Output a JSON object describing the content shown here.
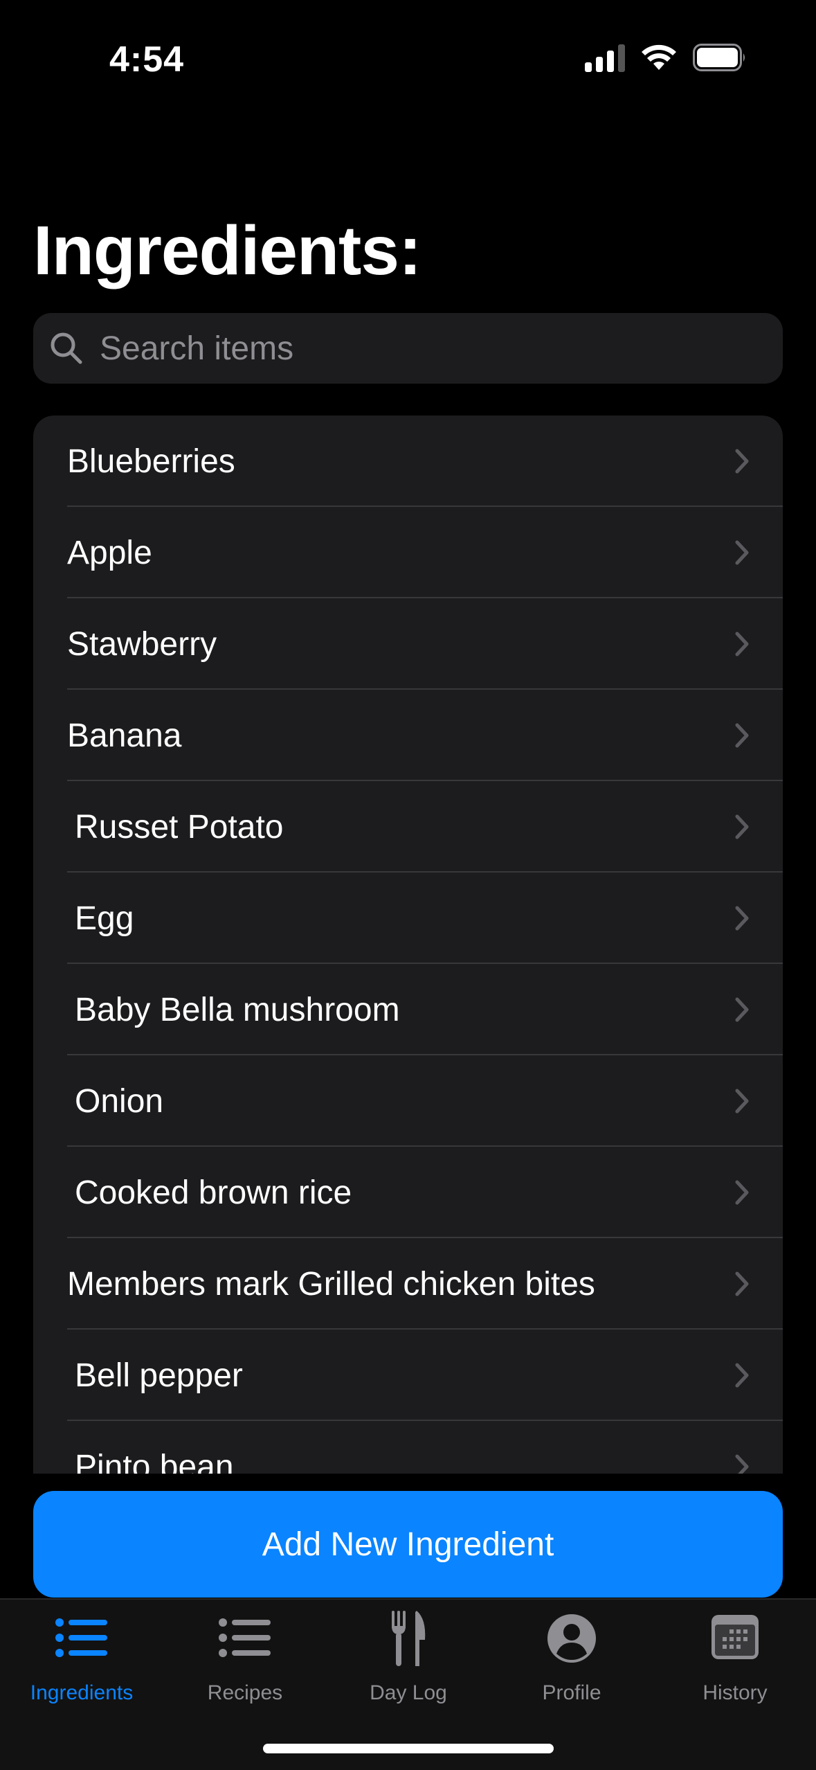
{
  "status_bar": {
    "time": "4:54"
  },
  "title": "Ingredients:",
  "search": {
    "placeholder": "Search items",
    "value": ""
  },
  "ingredients": [
    {
      "label": "Blueberries"
    },
    {
      "label": "Apple"
    },
    {
      "label": "Stawberry"
    },
    {
      "label": "Banana"
    },
    {
      "label": "Russet Potato"
    },
    {
      "label": "Egg"
    },
    {
      "label": "Baby Bella mushroom"
    },
    {
      "label": "Onion"
    },
    {
      "label": "Cooked brown rice"
    },
    {
      "label": "Members mark Grilled chicken bites"
    },
    {
      "label": "Bell pepper"
    },
    {
      "label": "Pinto bean"
    }
  ],
  "add_button": {
    "label": "Add New Ingredient"
  },
  "tabs": [
    {
      "label": "Ingredients",
      "icon": "list-bullet-icon",
      "active": true
    },
    {
      "label": "Recipes",
      "icon": "list-bullet-icon",
      "active": false
    },
    {
      "label": "Day Log",
      "icon": "fork-knife-icon",
      "active": false
    },
    {
      "label": "Profile",
      "icon": "person-circle-icon",
      "active": false
    },
    {
      "label": "History",
      "icon": "calendar-icon",
      "active": false
    }
  ],
  "colors": {
    "accent": "#0a84ff",
    "background": "#000000",
    "surface": "#1c1c1e",
    "separator": "#38383a",
    "secondary_text": "#8e8e93"
  }
}
